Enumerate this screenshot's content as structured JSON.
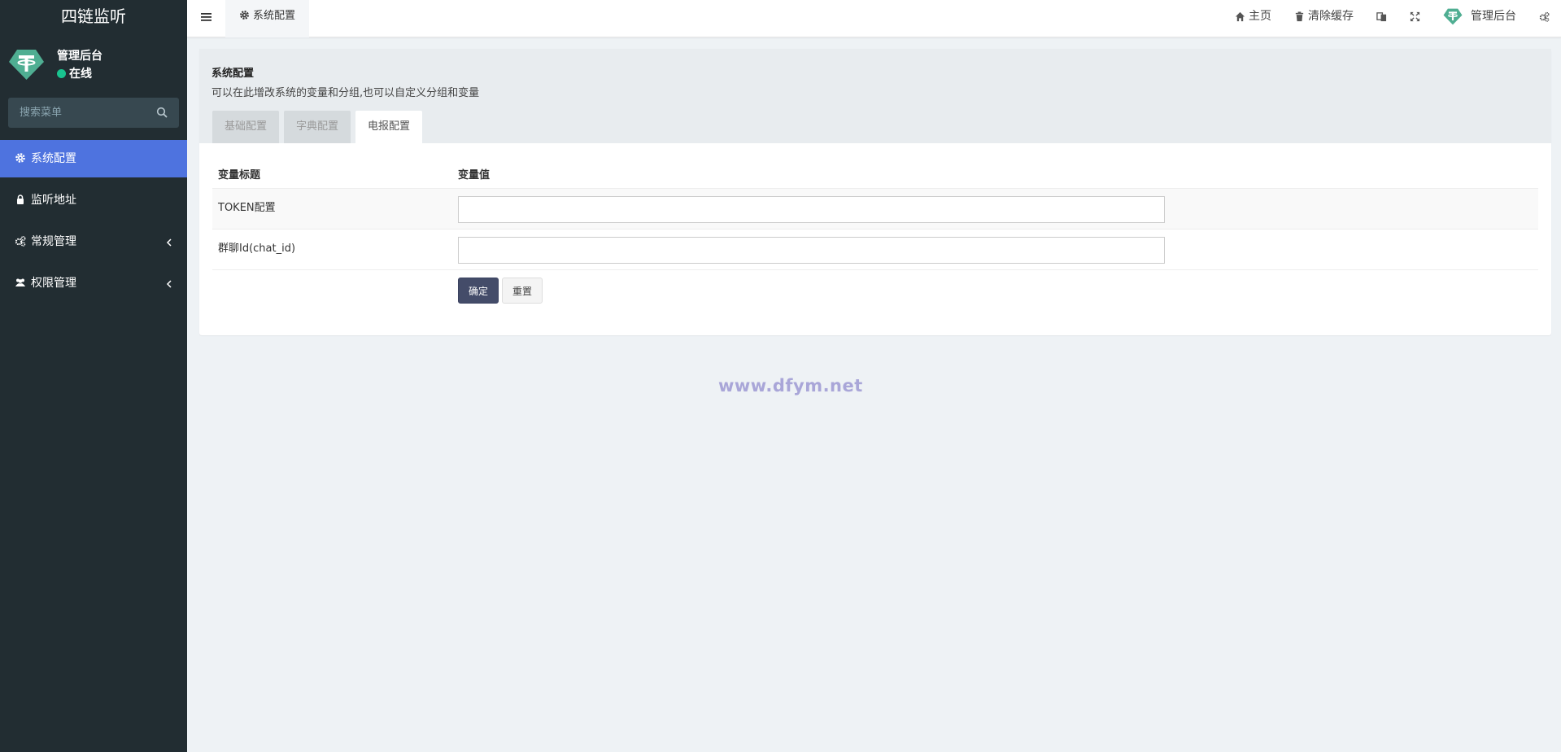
{
  "app": {
    "brand": "四链监听"
  },
  "user": {
    "name": "管理后台",
    "status": "在线"
  },
  "search": {
    "placeholder": "搜索菜单"
  },
  "menu": [
    {
      "label": "系统配置",
      "icon": "gear-icon",
      "active": true
    },
    {
      "label": "监听地址",
      "icon": "lock-icon"
    },
    {
      "label": "常规管理",
      "icon": "cogs-icon",
      "has_submenu": true
    },
    {
      "label": "权限管理",
      "icon": "users-icon",
      "has_submenu": true
    }
  ],
  "header": {
    "tab": "系统配置",
    "home": "主页",
    "clear_cache": "清除缓存",
    "user": "管理后台"
  },
  "panel": {
    "title": "系统配置",
    "desc": "可以在此增改系统的变量和分组,也可以自定义分组和变量",
    "tabs": [
      "基础配置",
      "字典配置",
      "电报配置"
    ],
    "active_tab": "电报配置",
    "col_title": "变量标题",
    "col_value": "变量值",
    "rows": [
      {
        "label": "TOKEN配置",
        "value": ""
      },
      {
        "label": "群聊Id(chat_id)",
        "value": ""
      }
    ],
    "submit": "确定",
    "reset": "重置"
  },
  "watermark": "www.dfym.net",
  "colors": {
    "sidebar": "#222d32",
    "active": "#4e73df",
    "online": "#19c38f",
    "primary_btn": "#444c69"
  }
}
